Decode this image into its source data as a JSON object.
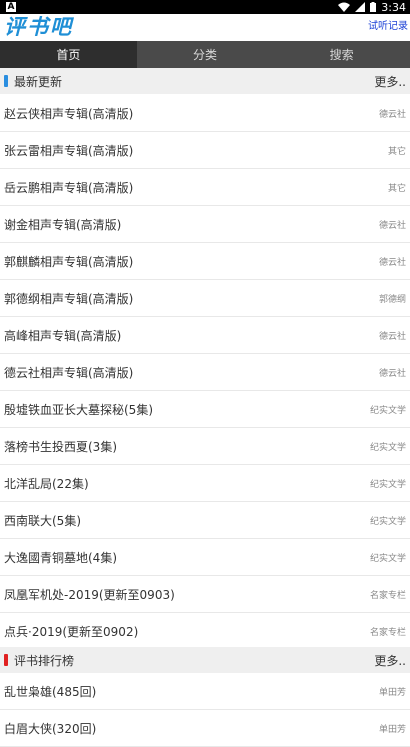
{
  "status_bar": {
    "left_icon": "A",
    "time": "3:34",
    "icons": [
      "wifi-icon",
      "signal-icon",
      "battery-icon"
    ]
  },
  "header": {
    "logo": "评书吧",
    "record_link": "试听记录"
  },
  "tabs": [
    {
      "label": "首页",
      "active": true
    },
    {
      "label": "分类",
      "active": false
    },
    {
      "label": "搜索",
      "active": false
    }
  ],
  "sections": [
    {
      "title": "最新更新",
      "more": "更多..",
      "bar_color": "#2a8ee0",
      "items": [
        {
          "title": "赵云侠相声专辑(高清版)",
          "category": "德云社"
        },
        {
          "title": "张云雷相声专辑(高清版)",
          "category": "其它"
        },
        {
          "title": "岳云鹏相声专辑(高清版)",
          "category": "其它"
        },
        {
          "title": "谢金相声专辑(高清版)",
          "category": "德云社"
        },
        {
          "title": "郭麒麟相声专辑(高清版)",
          "category": "德云社"
        },
        {
          "title": "郭德纲相声专辑(高清版)",
          "category": "郭德纲"
        },
        {
          "title": "高峰相声专辑(高清版)",
          "category": "德云社"
        },
        {
          "title": "德云社相声专辑(高清版)",
          "category": "德云社"
        },
        {
          "title": "殷墟铁血亚长大墓探秘(5集)",
          "category": "纪实文学"
        },
        {
          "title": "落榜书生投西夏(3集)",
          "category": "纪实文学"
        },
        {
          "title": "北洋乱局(22集)",
          "category": "纪实文学"
        },
        {
          "title": "西南联大(5集)",
          "category": "纪实文学"
        },
        {
          "title": "大逸國青铜墓地(4集)",
          "category": "纪实文学"
        },
        {
          "title": "凤凰军机处-2019(更新至0903)",
          "category": "名家专栏"
        },
        {
          "title": "点兵·2019(更新至0902)",
          "category": "名家专栏"
        }
      ]
    },
    {
      "title": "评书排行榜",
      "more": "更多..",
      "bar_color": "#e02020",
      "items": [
        {
          "title": "乱世枭雄(485回)",
          "category": "单田芳"
        },
        {
          "title": "白眉大侠(320回)",
          "category": "单田芳"
        }
      ]
    }
  ]
}
